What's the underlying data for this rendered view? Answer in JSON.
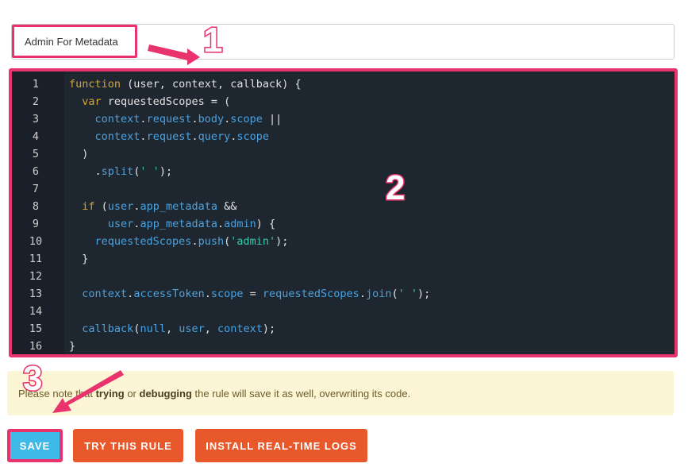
{
  "rule_name": {
    "value": "Admin For Metadata"
  },
  "editor": {
    "line_numbers": [
      "1",
      "2",
      "3",
      "4",
      "5",
      "6",
      "7",
      "8",
      "9",
      "10",
      "11",
      "12",
      "13",
      "14",
      "15",
      "16"
    ]
  },
  "callouts": {
    "one": "1",
    "two": "2",
    "three": "3"
  },
  "notice": {
    "part1": "Please note that ",
    "bold1": "trying",
    "part2": " or ",
    "bold2": "debugging",
    "part3": " the rule will save it as well, overwriting its code."
  },
  "buttons": {
    "save": "SAVE",
    "try": "TRY THIS RULE",
    "logs": "INSTALL REAL-TIME LOGS"
  },
  "colors": {
    "highlight": "#e8336d",
    "save_bg": "#3fb9e8",
    "action_bg": "#e8582a",
    "editor_bg": "#1e2630",
    "notice_bg": "#fcf6d6"
  }
}
